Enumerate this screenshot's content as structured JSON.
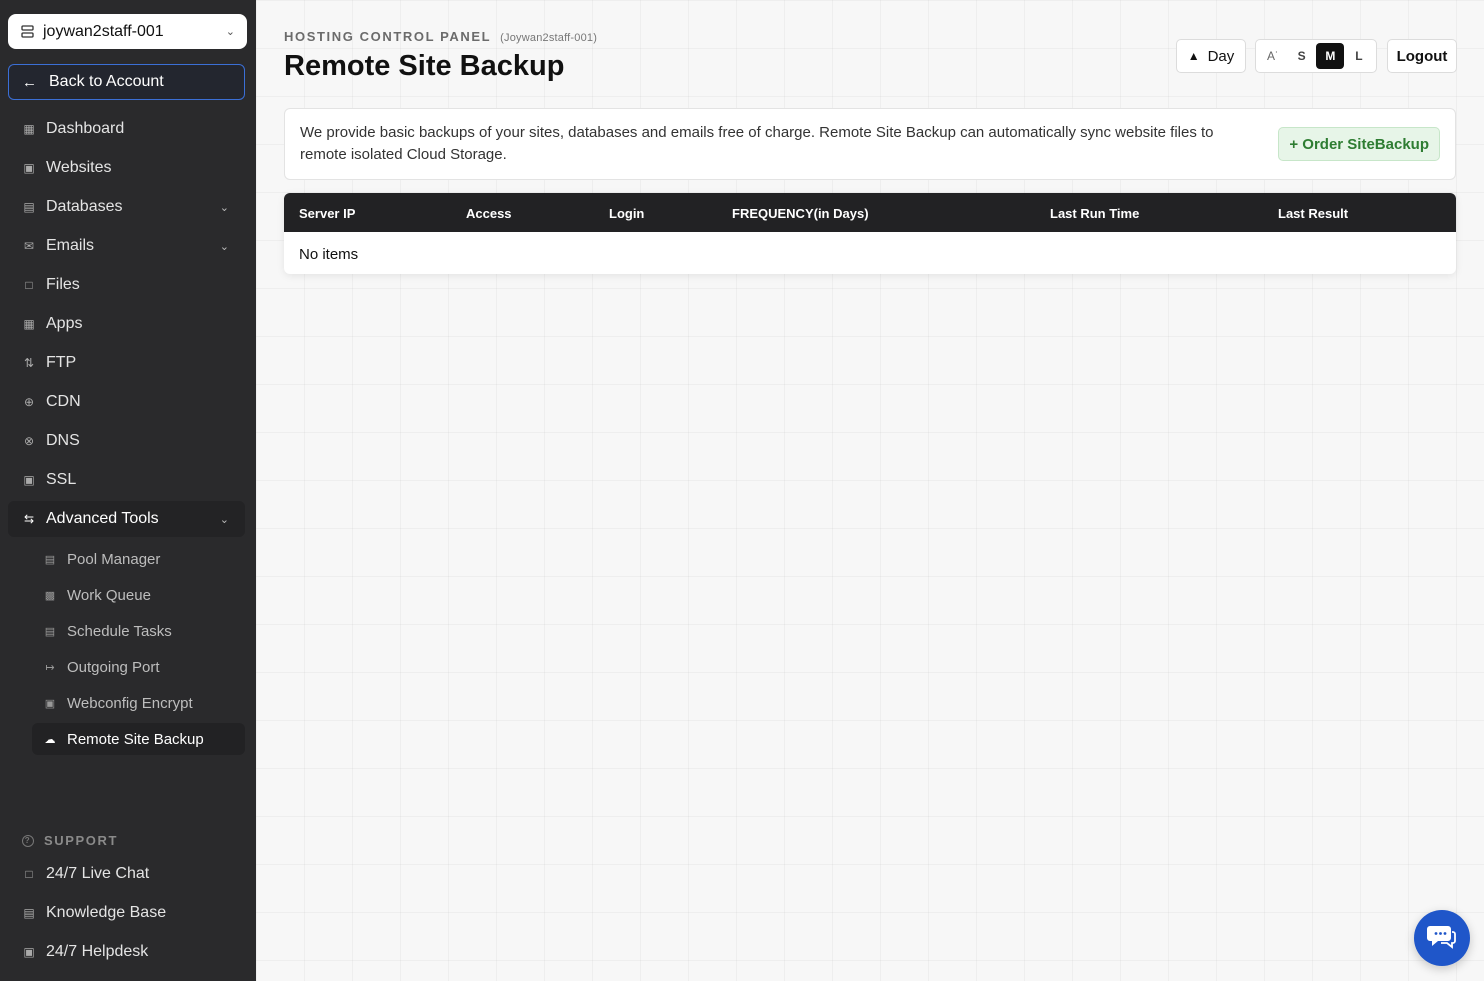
{
  "sidebar": {
    "account": "joywan2staff-001",
    "back_label": "Back to Account",
    "items": [
      {
        "label": "Dashboard",
        "icon": "grid-icon"
      },
      {
        "label": "Websites",
        "icon": "browser-icon"
      },
      {
        "label": "Databases",
        "icon": "database-icon"
      },
      {
        "label": "Emails",
        "icon": "mail-icon"
      },
      {
        "label": "Files",
        "icon": "folder-icon"
      },
      {
        "label": "Apps",
        "icon": "apps-icon"
      },
      {
        "label": "FTP",
        "icon": "transfer-icon"
      },
      {
        "label": "CDN",
        "icon": "globe-icon"
      },
      {
        "label": "DNS",
        "icon": "dns-icon"
      },
      {
        "label": "SSL",
        "icon": "lock-icon"
      },
      {
        "label": "Advanced Tools",
        "icon": "sliders-icon"
      }
    ],
    "sub_items": [
      {
        "label": "Pool Manager",
        "icon": "server-icon"
      },
      {
        "label": "Work Queue",
        "icon": "queue-icon"
      },
      {
        "label": "Schedule Tasks",
        "icon": "calendar-icon"
      },
      {
        "label": "Outgoing Port",
        "icon": "arrow-out-icon"
      },
      {
        "label": "Webconfig Encrypt",
        "icon": "lock-icon"
      },
      {
        "label": "Remote Site Backup",
        "icon": "cloud-icon"
      }
    ],
    "support_label": "SUPPORT",
    "support_items": [
      {
        "label": "24/7 Live Chat",
        "icon": "chat-icon"
      },
      {
        "label": "Knowledge Base",
        "icon": "book-icon"
      },
      {
        "label": "24/7 Helpdesk",
        "icon": "ticket-icon"
      }
    ]
  },
  "header": {
    "crumb": "HOSTING CONTROL PANEL",
    "crumb_account": "(Joywan2staff-001)",
    "title": "Remote Site Backup",
    "day_label": "Day",
    "sizes": [
      "S",
      "M",
      "L"
    ],
    "size_selected": "M",
    "logout_label": "Logout"
  },
  "info": {
    "text": "We provide basic backups of your sites, databases and emails free of charge. Remote Site Backup can automatically sync website files to remote isolated Cloud Storage.",
    "order_label": "+ Order SiteBackup"
  },
  "table": {
    "columns": [
      "Server IP",
      "Access",
      "Login",
      "FREQUENCY(in Days)",
      "Last Run Time",
      "Last Result"
    ],
    "empty_text": "No items"
  },
  "colors": {
    "sidebar_bg": "#2a2a2c",
    "accent_blue": "#1f56c9",
    "order_green": "#2e7d32"
  }
}
